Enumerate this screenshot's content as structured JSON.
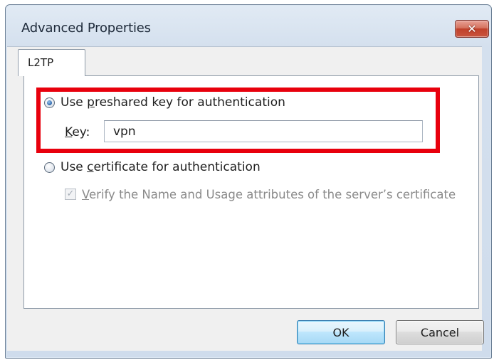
{
  "window": {
    "title": "Advanced Properties",
    "close_glyph": "✕"
  },
  "tabs": [
    {
      "label": "L2TP",
      "selected": true
    }
  ],
  "auth": {
    "preshared_option": {
      "prefix": "Use ",
      "mnemonic": "p",
      "suffix": "reshared key for authentication",
      "selected": true
    },
    "key_label": {
      "mnemonic": "K",
      "suffix": "ey:"
    },
    "key_value": "vpn",
    "certificate_option": {
      "prefix": "Use ",
      "mnemonic": "c",
      "suffix": "ertificate for authentication",
      "selected": false
    },
    "verify_checkbox": {
      "mnemonic": "V",
      "suffix": "erify the Name and Usage attributes of the server’s certificate",
      "checked": true,
      "enabled": false,
      "check_glyph": "✓"
    }
  },
  "buttons": {
    "ok_label": "OK",
    "cancel_label": "Cancel"
  },
  "colors": {
    "highlight_box": "#e8000d",
    "close_button": "#c0402a",
    "default_button_border": "#3c7fb1"
  }
}
